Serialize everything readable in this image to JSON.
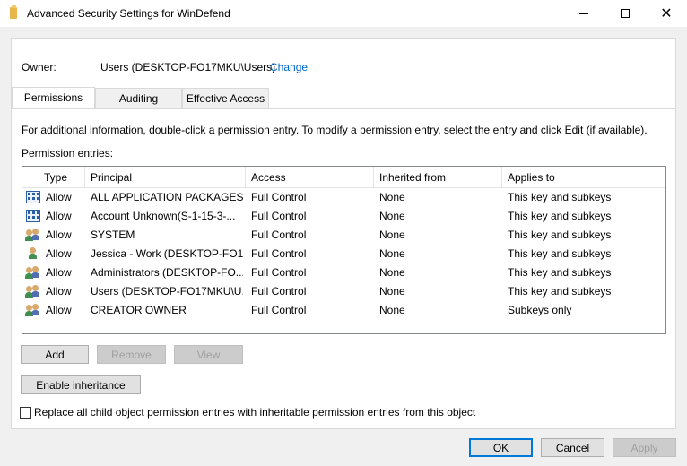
{
  "window": {
    "title": "Advanced Security Settings for WinDefend",
    "minimize_icon": "minimize-icon",
    "maximize_icon": "maximize-icon",
    "close_icon": "close-icon"
  },
  "owner": {
    "label": "Owner:",
    "value": "Users (DESKTOP-FO17MKU\\Users)",
    "change_link": "Change"
  },
  "tabs": [
    {
      "label": "Permissions",
      "active": true
    },
    {
      "label": "Auditing",
      "active": false
    },
    {
      "label": "Effective Access",
      "active": false
    }
  ],
  "permissions": {
    "info_text": "For additional information, double-click a permission entry. To modify a permission entry, select the entry and click Edit (if available).",
    "entries_label": "Permission entries:",
    "columns": [
      "Type",
      "Principal",
      "Access",
      "Inherited from",
      "Applies to"
    ],
    "rows": [
      {
        "icon": "app-package-icon",
        "type": "Allow",
        "principal": "ALL APPLICATION PACKAGES",
        "access": "Full Control",
        "inherited": "None",
        "applies": "This key and subkeys"
      },
      {
        "icon": "app-package-icon",
        "type": "Allow",
        "principal": "Account Unknown(S-1-15-3-...",
        "access": "Full Control",
        "inherited": "None",
        "applies": "This key and subkeys"
      },
      {
        "icon": "group-icon",
        "type": "Allow",
        "principal": "SYSTEM",
        "access": "Full Control",
        "inherited": "None",
        "applies": "This key and subkeys"
      },
      {
        "icon": "user-icon",
        "type": "Allow",
        "principal": "Jessica - Work (DESKTOP-FO1...",
        "access": "Full Control",
        "inherited": "None",
        "applies": "This key and subkeys"
      },
      {
        "icon": "group-icon",
        "type": "Allow",
        "principal": "Administrators (DESKTOP-FO...",
        "access": "Full Control",
        "inherited": "None",
        "applies": "This key and subkeys"
      },
      {
        "icon": "group-icon",
        "type": "Allow",
        "principal": "Users (DESKTOP-FO17MKU\\U...",
        "access": "Full Control",
        "inherited": "None",
        "applies": "This key and subkeys"
      },
      {
        "icon": "group-icon",
        "type": "Allow",
        "principal": "CREATOR OWNER",
        "access": "Full Control",
        "inherited": "None",
        "applies": "Subkeys only"
      }
    ],
    "buttons": {
      "add": "Add",
      "remove": "Remove",
      "view": "View",
      "enable_inheritance": "Enable inheritance"
    },
    "replace_checkbox_label": "Replace all child object permission entries with inheritable permission entries from this object",
    "replace_checked": false
  },
  "footer": {
    "ok": "OK",
    "cancel": "Cancel",
    "apply": "Apply"
  },
  "colors": {
    "link": "#0066cc",
    "focus_border": "#0078d7",
    "window_bg": "#f0f0f0"
  }
}
